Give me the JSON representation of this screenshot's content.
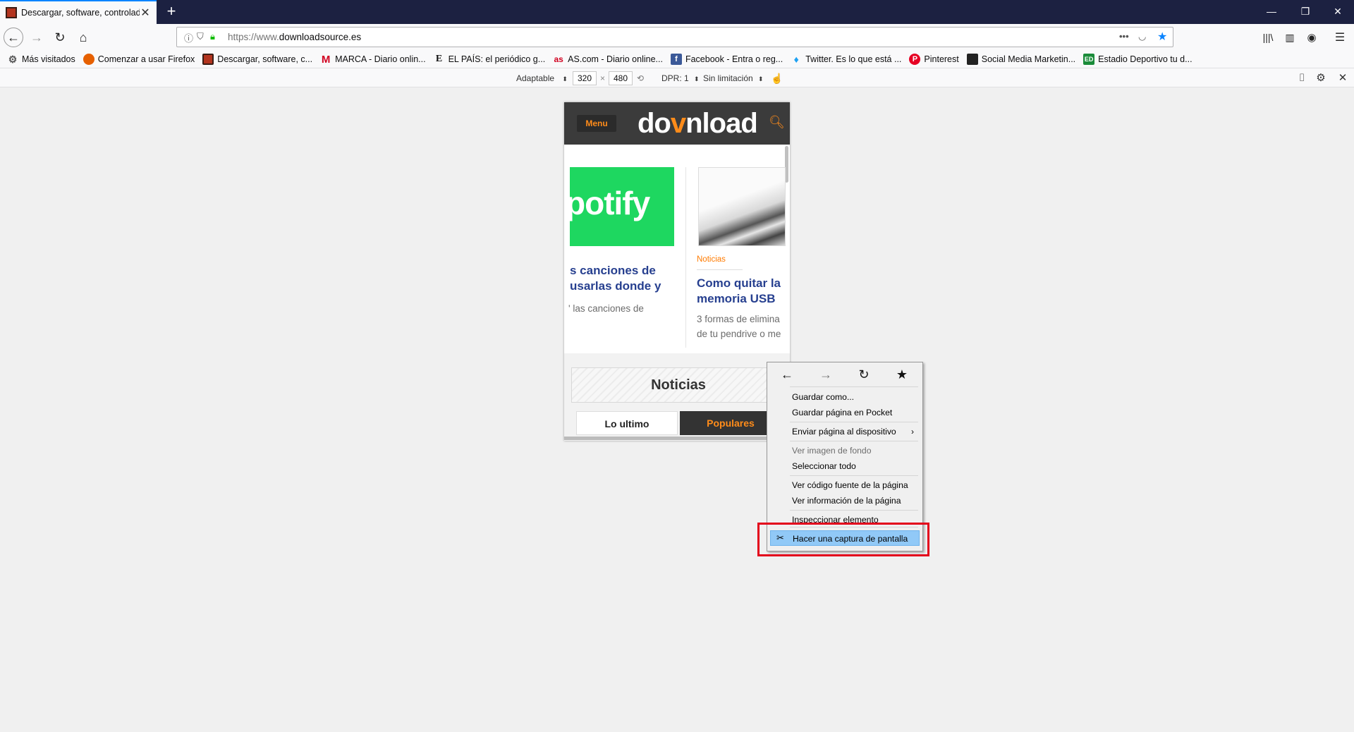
{
  "tab": {
    "title": "Descargar, software, controlado"
  },
  "window_controls": {
    "minimize": "—",
    "restore": "❐",
    "close": "✕"
  },
  "url": {
    "scheme": "https://www.",
    "host": "downloadsource.es"
  },
  "bookmarks": [
    {
      "label": "Más visitados",
      "icon": "gear-icon",
      "color": "#555555"
    },
    {
      "label": "Comenzar a usar Firefox",
      "icon": "firefox-icon",
      "color": "#e66000"
    },
    {
      "label": "Descargar, software, c...",
      "icon": "downloadsource-icon",
      "color": "#b3341e"
    },
    {
      "label": "MARCA - Diario onlin...",
      "icon": "marca-icon",
      "color": "#d1001f"
    },
    {
      "label": "EL PAÍS: el periódico g...",
      "icon": "elpais-icon",
      "color": "#111111"
    },
    {
      "label": "AS.com - Diario online...",
      "icon": "as-icon",
      "color": "#d1001f"
    },
    {
      "label": "Facebook - Entra o reg...",
      "icon": "facebook-icon",
      "color": "#3b5998"
    },
    {
      "label": "Twitter. Es lo que está ...",
      "icon": "twitter-icon",
      "color": "#1da1f2"
    },
    {
      "label": "Pinterest",
      "icon": "pinterest-icon",
      "color": "#e60023"
    },
    {
      "label": "Social Media Marketin...",
      "icon": "socialmedia-icon",
      "color": "#222222"
    },
    {
      "label": "Estadio Deportivo tu d...",
      "icon": "estadio-icon",
      "color": "#1b8c3a"
    }
  ],
  "rdm": {
    "device": "Adaptable",
    "width": "320",
    "times": "×",
    "height": "480",
    "dpr": "DPR: 1",
    "throttle": "Sin limitación"
  },
  "site": {
    "menu_label": "Menu",
    "logo_pre": "do",
    "logo_mid": "v",
    "logo_post": "nload",
    "card1": {
      "image_text": "potify",
      "title_line1": "s canciones de",
      "title_line2": "usarlas donde y",
      "desc_line1": "' las canciones de"
    },
    "card2": {
      "category": "Noticias",
      "title_line1": "Como quitar la",
      "title_line2": "memoria USB",
      "desc_line1": "3 formas de elimina",
      "desc_line2": "de tu pendrive o me"
    },
    "section_title": "Noticias",
    "tab_latest": "Lo ultimo",
    "tab_popular": "Populares"
  },
  "context_menu": {
    "nav": {
      "back": "←",
      "forward": "→",
      "reload": "↻",
      "bookmark": "★"
    },
    "items": [
      {
        "label": "Guardar como..."
      },
      {
        "label": "Guardar página en Pocket"
      },
      {
        "label": "Enviar página al dispositivo",
        "submenu": "›"
      },
      {
        "label": "Ver imagen de fondo",
        "disabled": true
      },
      {
        "label": "Seleccionar todo"
      },
      {
        "label": "Ver código fuente de la página"
      },
      {
        "label": "Ver información de la página"
      },
      {
        "label": "Inspeccionar elemento"
      },
      {
        "label": "Hacer una captura de pantalla",
        "highlighted": true
      }
    ]
  },
  "colors": {
    "accent": "#ff8c1a",
    "highlight_box": "#e3001b",
    "menu_hover": "#91c9f7"
  }
}
